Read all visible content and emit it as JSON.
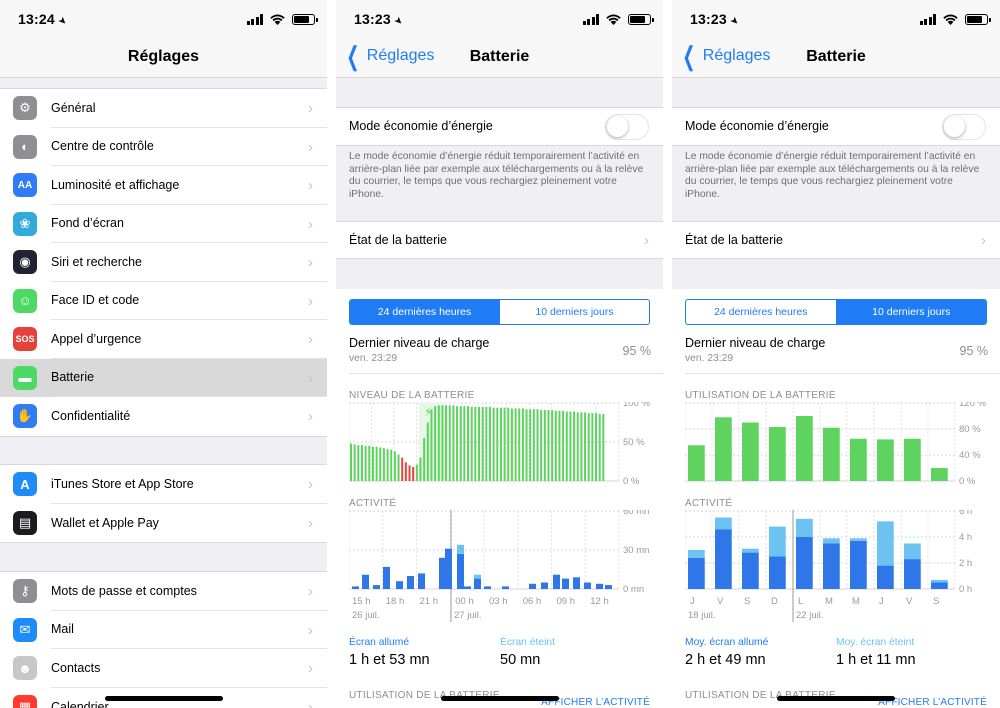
{
  "status": {
    "time1": "13:24",
    "time2": "13:23",
    "time3": "13:23"
  },
  "settings": {
    "title": "Réglages",
    "group1": [
      {
        "label": "Général",
        "icon": "gear-icon",
        "color": "#8e8e93"
      },
      {
        "label": "Centre de contrôle",
        "icon": "toggles-icon",
        "color": "#8e8e93"
      },
      {
        "label": "Luminosité et affichage",
        "icon": "text-size-icon",
        "color": "#2f7cf6"
      },
      {
        "label": "Fond d’écran",
        "icon": "flower-icon",
        "color": "#34aadc"
      },
      {
        "label": "Siri et recherche",
        "icon": "siri-icon",
        "color": "#222233"
      },
      {
        "label": "Face ID et code",
        "icon": "face-id-icon",
        "color": "#4cd964"
      },
      {
        "label": "Appel d’urgence",
        "icon": "sos-icon",
        "color": "#e6413a"
      },
      {
        "label": "Batterie",
        "icon": "battery-icon",
        "color": "#4cd964"
      },
      {
        "label": "Confidentialité",
        "icon": "hand-icon",
        "color": "#2f7cf6"
      }
    ],
    "group2": [
      {
        "label": "iTunes Store et App Store",
        "icon": "app-store-icon",
        "color": "#1d8cf6"
      },
      {
        "label": "Wallet et Apple Pay",
        "icon": "wallet-icon",
        "color": "#1c1c1e"
      }
    ],
    "group3": [
      {
        "label": "Mots de passe et comptes",
        "icon": "key-icon",
        "color": "#8e8e93"
      },
      {
        "label": "Mail",
        "icon": "mail-icon",
        "color": "#1d8cf6"
      },
      {
        "label": "Contacts",
        "icon": "contacts-icon",
        "color": "#c7c7c7"
      },
      {
        "label": "Calendrier",
        "icon": "calendar-icon",
        "color": "#ff3b30"
      }
    ],
    "sos_text": "SOS",
    "aa_text": "AA"
  },
  "battery": {
    "back": "Réglages",
    "title": "Batterie",
    "low_power": "Mode économie d’énergie",
    "low_power_on": false,
    "footer": "Le mode économie d’énergie réduit temporairement l’activité en arrière-plan liée par exemple aux téléchargements ou à la relève du courrier, le temps que vous rechargiez pleinement votre iPhone.",
    "health": "État de la batterie",
    "tab_24h": "24 dernières heures",
    "tab_10d": "10 derniers jours",
    "last_charge": "Dernier niveau de charge",
    "last_charge_time": "ven. 23:29",
    "last_charge_value": "95 %",
    "level_header": "NIVEAU DE LA BATTERIE",
    "usage_header": "UTILISATION DE LA BATTERIE",
    "activity_header": "ACTIVITÉ",
    "screen_on": "Écran allumé",
    "screen_on_value": "1 h et 53 mn",
    "screen_off": "Écran éteint",
    "screen_off_value": "50 mn",
    "avg_screen_on": "Moy. écran allumé",
    "avg_screen_on_value": "2 h et 49 mn",
    "avg_screen_off": "Moy. écran éteint",
    "avg_screen_off_value": "1 h et 11 mn",
    "bottom_header": "UTILISATION DE LA BATTERIE",
    "show_activity": "AFFICHER L’ACTIVITÉ",
    "colors": {
      "green": "#5fd35f",
      "red": "#e8453c",
      "blue": "#2f77e8",
      "lightblue": "#6cc3f2",
      "accent": "#1f7cf5"
    }
  },
  "chart_data": [
    {
      "type": "bar",
      "title": "NIVEAU DE LA BATTERIE",
      "ylabel": "",
      "y_ticks": [
        "100 %",
        "50 %",
        "0 %"
      ],
      "ylim": [
        0,
        100
      ],
      "series": [
        {
          "values": [
            48,
            47,
            46,
            46,
            45,
            45,
            44,
            44,
            43,
            42,
            41,
            40,
            38,
            34,
            30,
            24,
            20,
            18,
            21,
            30,
            55,
            75,
            92,
            96,
            97,
            97,
            97,
            97,
            97,
            96,
            96,
            96,
            96,
            95,
            95,
            95,
            95,
            95,
            95,
            94,
            94,
            94,
            94,
            94,
            93,
            93,
            93,
            93,
            92,
            92,
            92,
            92,
            91,
            91,
            91,
            91,
            90,
            90,
            90,
            89,
            89,
            89,
            88,
            88,
            88,
            87,
            87,
            87,
            86,
            86
          ]
        }
      ],
      "low_indices": [
        14,
        15,
        16,
        17
      ]
    },
    {
      "type": "bar",
      "title": "ACTIVITÉ",
      "y_ticks": [
        "60 mn",
        "30 mn",
        "0 mn"
      ],
      "ylim": [
        0,
        60
      ],
      "categories": [
        "15 h",
        "",
        "18 h",
        "",
        "21 h",
        "",
        "00 h",
        "",
        "03 h",
        "",
        "06 h",
        "",
        "09 h",
        "",
        "12 h",
        ""
      ],
      "x_labels": [
        "15 h",
        "18 h",
        "21 h",
        "00 h",
        "03 h",
        "06 h",
        "09 h",
        "12 h"
      ],
      "date_labels": [
        "26 juil.",
        "27 juil."
      ],
      "series": [
        {
          "name": "Écran allumé",
          "values": [
            2,
            11,
            3,
            17,
            6,
            10,
            12,
            0,
            0,
            0,
            0,
            0,
            0,
            0,
            0,
            0,
            0,
            0,
            0,
            0,
            0,
            0,
            0,
            0,
            0,
            0,
            0,
            0,
            0,
            0,
            0,
            0,
            0,
            0,
            0,
            0,
            0,
            0,
            0,
            0,
            0,
            0,
            8,
            3,
            0,
            0
          ]
        },
        {
          "name": "Écran éteint",
          "values": [
            0,
            0,
            0,
            0,
            0,
            0,
            0,
            0,
            0,
            0,
            0,
            0,
            0,
            0,
            0,
            0,
            0,
            0,
            0,
            0,
            0,
            0,
            0,
            0,
            0,
            0,
            0,
            0,
            0,
            0,
            0,
            0,
            0,
            0,
            0,
            0,
            0,
            0,
            0,
            0,
            0,
            0,
            0,
            0,
            0,
            0
          ]
        }
      ],
      "bars": [
        {
          "on": 2,
          "off": 0
        },
        {
          "on": 11,
          "off": 0
        },
        {
          "on": 3,
          "off": 0
        },
        {
          "on": 17,
          "off": 0
        },
        {
          "on": 6,
          "off": 0
        },
        {
          "on": 10,
          "off": 0
        },
        {
          "on": 12,
          "off": 0
        },
        {
          "on": 0,
          "off": 0
        },
        {
          "on": 24,
          "off": 0
        },
        {
          "on": 31,
          "off": 0
        },
        {
          "on": 27,
          "off": 7
        },
        {
          "on": 2,
          "off": 0
        },
        {
          "on": 8,
          "off": 3
        },
        {
          "on": 2,
          "off": 0
        }
      ],
      "bars2": [
        {
          "on": 2,
          "off": 0
        },
        {
          "on": 4,
          "off": 0
        },
        {
          "on": 5,
          "off": 0
        },
        {
          "on": 11,
          "off": 0
        },
        {
          "on": 8,
          "off": 0
        },
        {
          "on": 9,
          "off": 0
        },
        {
          "on": 5,
          "off": 0
        },
        {
          "on": 4,
          "off": 0
        },
        {
          "on": 3,
          "off": 0
        }
      ]
    },
    {
      "type": "bar",
      "title": "UTILISATION DE LA BATTERIE",
      "y_ticks": [
        "120 %",
        "80 %",
        "40 %",
        "0 %"
      ],
      "ylim": [
        0,
        120
      ],
      "categories": [
        "J",
        "V",
        "S",
        "D",
        "L",
        "M",
        "M",
        "J",
        "V",
        "S"
      ],
      "values": [
        55,
        98,
        90,
        83,
        100,
        82,
        65,
        64,
        65,
        20
      ]
    },
    {
      "type": "bar",
      "title": "ACTIVITÉ",
      "y_ticks": [
        "6 h",
        "4 h",
        "2 h",
        "0 h"
      ],
      "ylim": [
        0,
        6
      ],
      "categories": [
        "J",
        "V",
        "S",
        "D",
        "L",
        "M",
        "M",
        "J",
        "V",
        "S"
      ],
      "date_labels": [
        "18 juil.",
        "22 juil."
      ],
      "series": [
        {
          "name": "Moy. écran allumé",
          "values": [
            2.4,
            4.6,
            2.8,
            2.5,
            4.0,
            3.5,
            3.7,
            1.8,
            2.3,
            0.5
          ]
        },
        {
          "name": "Moy. écran éteint",
          "values": [
            0.6,
            0.9,
            0.3,
            2.3,
            1.4,
            0.4,
            0.2,
            3.4,
            1.2,
            0.2
          ]
        }
      ]
    }
  ]
}
